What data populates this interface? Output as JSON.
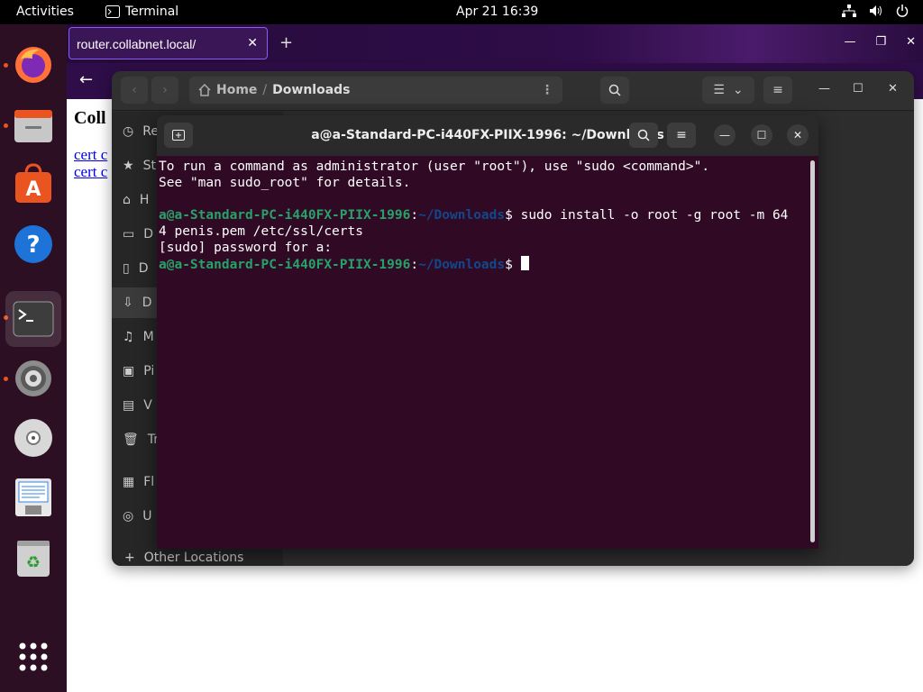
{
  "topbar": {
    "activities": "Activities",
    "app_name": "Terminal",
    "clock": "Apr 21  16:39"
  },
  "dock": {
    "items": [
      "firefox-icon",
      "files-icon",
      "app-center-icon",
      "help-icon",
      "terminal-icon",
      "settings-icon",
      "optical-drive-icon",
      "text-editor-icon",
      "trash-icon",
      "show-apps-icon"
    ]
  },
  "browser": {
    "tab_title": "router.collabnet.local/",
    "page_heading": "Coll",
    "links": [
      "cert c",
      "cert c"
    ]
  },
  "files": {
    "breadcrumb_home": "Home",
    "breadcrumb_current": "Downloads",
    "sidebar": [
      {
        "label": "Re",
        "icon": "clock-icon"
      },
      {
        "label": "St",
        "icon": "star-icon"
      },
      {
        "label": "H",
        "icon": "home-icon"
      },
      {
        "label": "D",
        "icon": "desktop-icon"
      },
      {
        "label": "D",
        "icon": "document-icon"
      },
      {
        "label": "D",
        "icon": "download-icon"
      },
      {
        "label": "M",
        "icon": "music-icon"
      },
      {
        "label": "Pi",
        "icon": "picture-icon"
      },
      {
        "label": "V",
        "icon": "video-icon"
      },
      {
        "label": "Tr",
        "icon": "trash-icon"
      },
      {
        "label": "Fl",
        "icon": "floppy-icon"
      },
      {
        "label": "U",
        "icon": "disc-icon"
      }
    ],
    "other_locations": "Other Locations"
  },
  "terminal": {
    "title": "a@a-Standard-PC-i440FX-PIIX-1996: ~/Downloads",
    "lines": {
      "l1": "To run a command as administrator (user \"root\"), use \"sudo <command>\".",
      "l2": "See \"man sudo_root\" for details.",
      "prompt_user": "a@a-Standard-PC-i440FX-PIIX-1996",
      "prompt_colon": ":",
      "prompt_path": "~/Downloads",
      "prompt_dollar": "$ ",
      "cmd1": "sudo install -o root -g root -m 64",
      "cmd1_wrap": "4 penis.pem /etc/ssl/certs",
      "sudo_prompt": "[sudo] password for a:"
    }
  },
  "colors": {
    "terminal_bg": "#300a24",
    "prompt_user": "#26a269",
    "prompt_path": "#12488b",
    "dock_bg": "#2c0f22"
  }
}
